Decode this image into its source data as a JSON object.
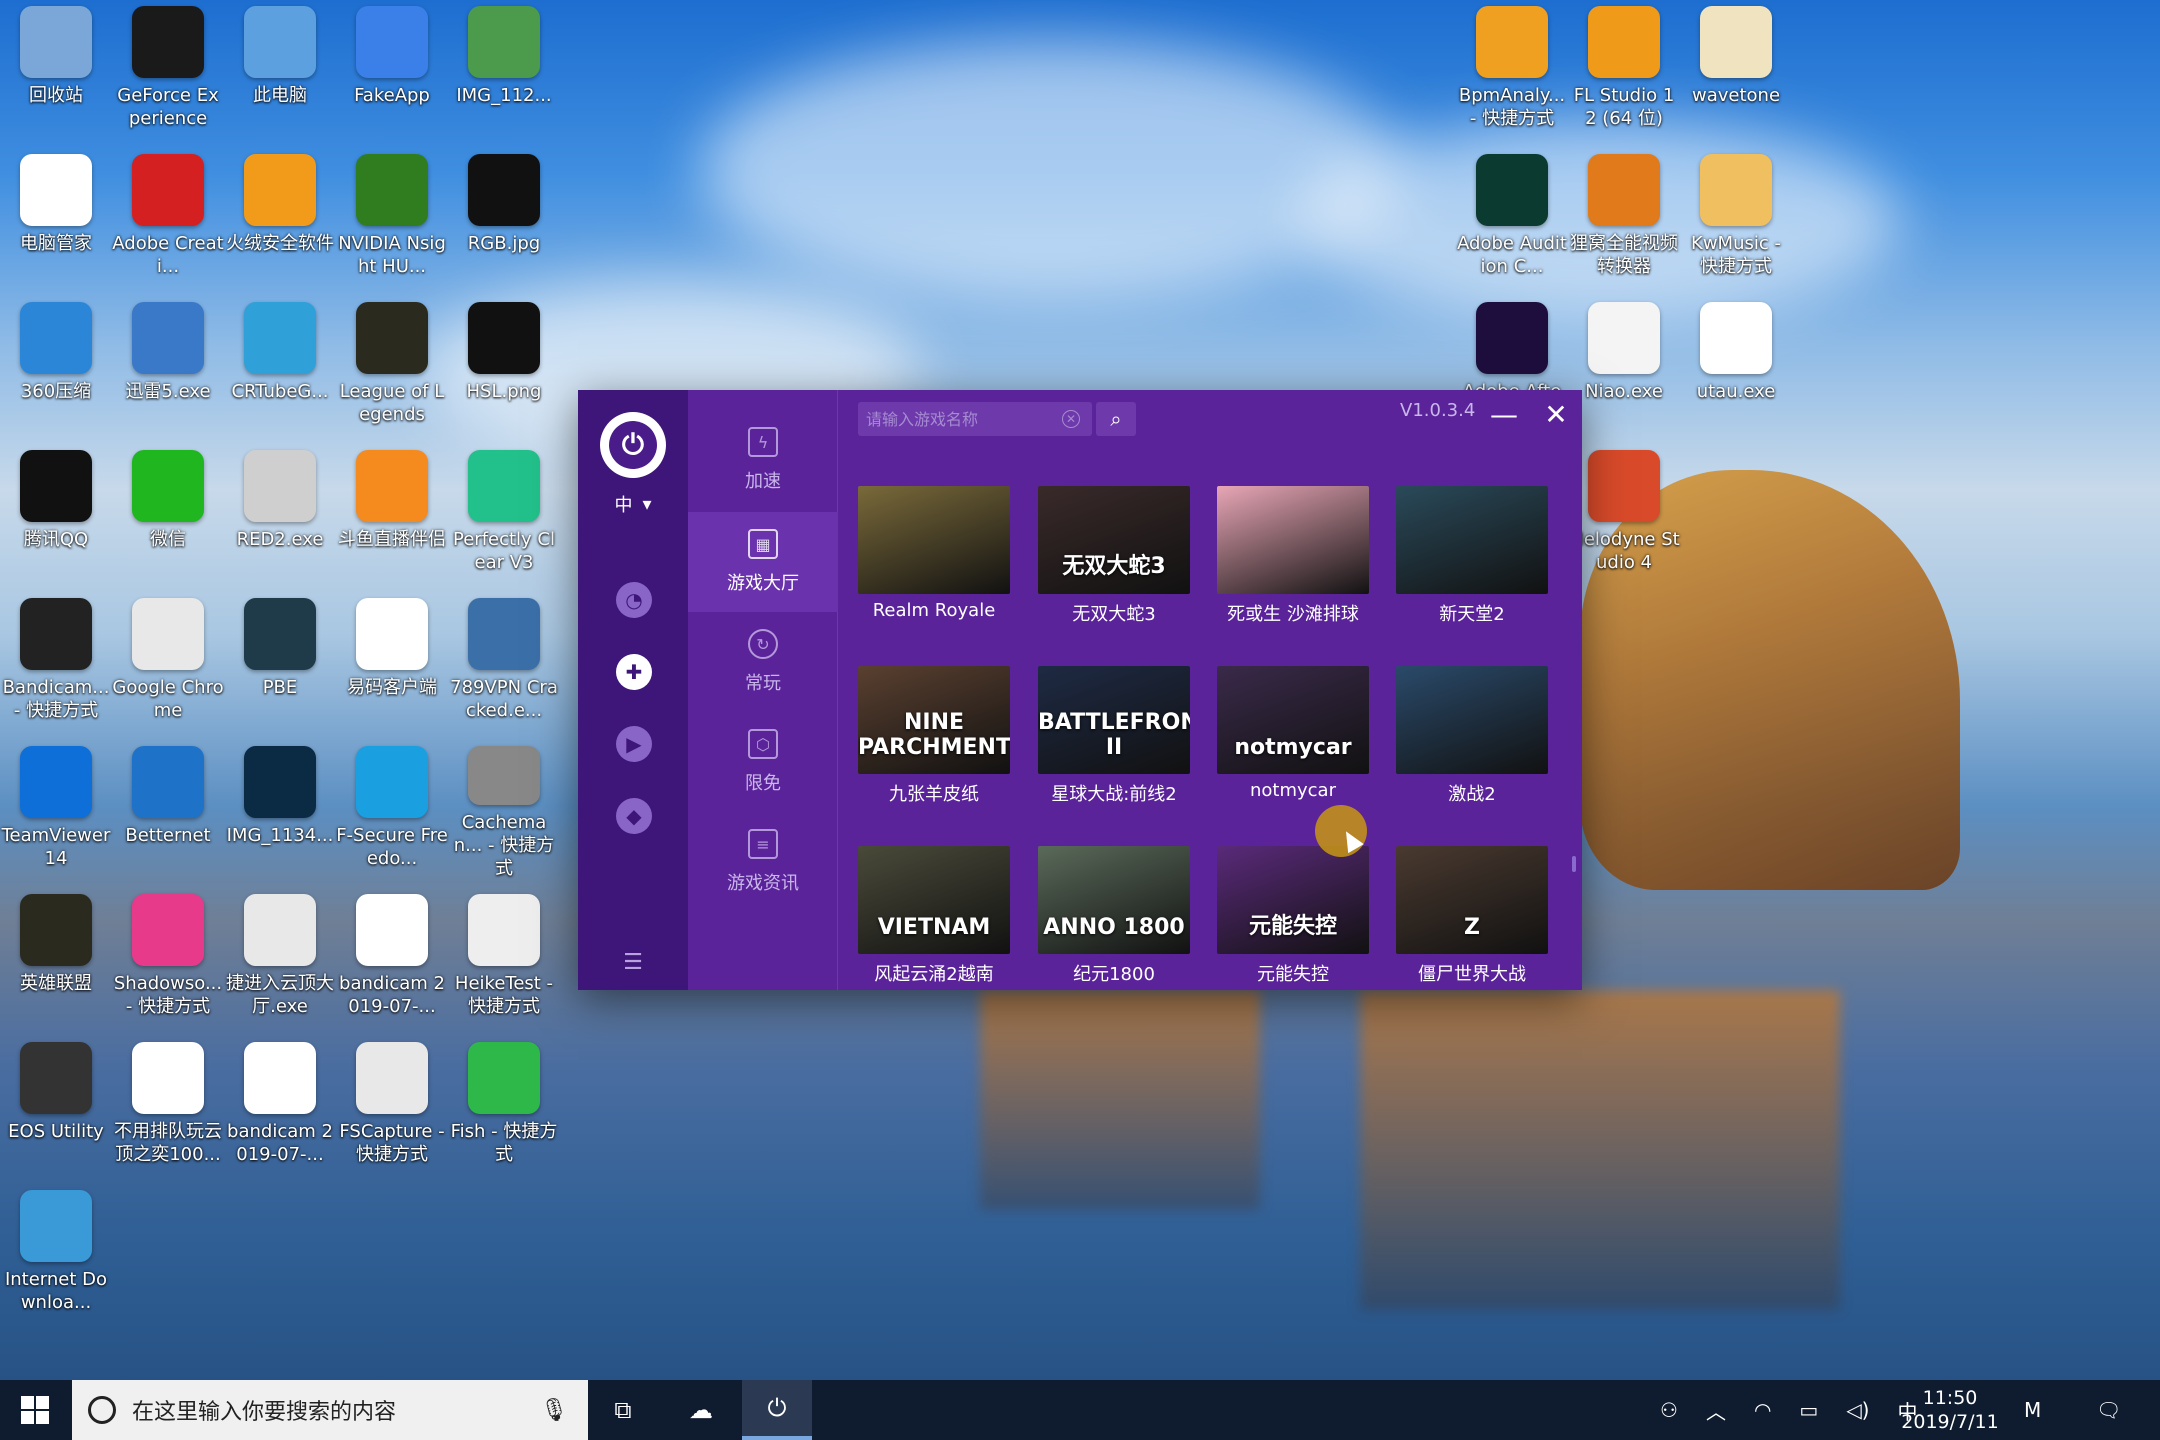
{
  "desktop_icons": [
    {
      "label": "回收站",
      "icon": "recycle-bin-icon",
      "color": "#7aa7d8"
    },
    {
      "label": "GeForce Experience",
      "icon": "nvidia-icon",
      "color": "#1a1a1a"
    },
    {
      "label": "此电脑",
      "icon": "computer-icon",
      "color": "#5da0e0"
    },
    {
      "label": "FakeApp",
      "icon": "fakeapp-icon",
      "color": "#3b7fe8"
    },
    {
      "label": "IMG_112...",
      "icon": "image-icon",
      "color": "#4c9a4c"
    },
    {
      "label": "电脑管家",
      "icon": "pc-manager-icon",
      "color": "#ffffff"
    },
    {
      "label": "Adobe Creati...",
      "icon": "adobe-cc-icon",
      "color": "#d42020"
    },
    {
      "label": "火绒安全软件",
      "icon": "huorong-icon",
      "color": "#f29a1a"
    },
    {
      "label": "NVIDIA Nsight HU...",
      "icon": "nsight-icon",
      "color": "#2f7d1e"
    },
    {
      "label": "RGB.jpg",
      "icon": "image-icon",
      "color": "#111111"
    },
    {
      "label": "360压缩",
      "icon": "archive-icon",
      "color": "#2b86d8"
    },
    {
      "label": "迅雷5.exe",
      "icon": "thunder-icon",
      "color": "#3a78c8"
    },
    {
      "label": "CRTubeG...",
      "icon": "crtube-icon",
      "color": "#2fa0d8"
    },
    {
      "label": "League of Legends",
      "icon": "lol-icon",
      "color": "#2b2a1e"
    },
    {
      "label": "HSL.png",
      "icon": "image-icon",
      "color": "#111111"
    },
    {
      "label": "腾讯QQ",
      "icon": "qq-icon",
      "color": "#111111"
    },
    {
      "label": "微信",
      "icon": "wechat-icon",
      "color": "#1fb61f"
    },
    {
      "label": "RED2.exe",
      "icon": "red2-icon",
      "color": "#cfcfcf"
    },
    {
      "label": "斗鱼直播伴侣",
      "icon": "douyu-icon",
      "color": "#f58a1e"
    },
    {
      "label": "Perfectly Clear V3",
      "icon": "perfectly-clear-icon",
      "color": "#22c08a"
    },
    {
      "label": "Bandicam... - 快捷方式",
      "icon": "bandicam-icon",
      "color": "#222222"
    },
    {
      "label": "Google Chrome",
      "icon": "chrome-icon",
      "color": "#e8e8e8"
    },
    {
      "label": "PBE",
      "icon": "lol-icon",
      "color": "#1f3a48"
    },
    {
      "label": "易码客户端",
      "icon": "yima-icon",
      "color": "#ffffff"
    },
    {
      "label": "789VPN Cracked.e...",
      "icon": "vpn-icon",
      "color": "#3b6fa8"
    },
    {
      "label": "TeamViewer 14",
      "icon": "teamviewer-icon",
      "color": "#0e6fd8"
    },
    {
      "label": "Betternet",
      "icon": "betternet-icon",
      "color": "#1e72c8"
    },
    {
      "label": "IMG_1134...",
      "icon": "photoshop-icon",
      "color": "#0b2a44"
    },
    {
      "label": "F-Secure Freedo...",
      "icon": "fsecure-icon",
      "color": "#1aa0e0"
    },
    {
      "label": "Cacheman... - 快捷方式",
      "icon": "cacheman-icon",
      "color": "#888888"
    },
    {
      "label": "英雄联盟",
      "icon": "lol-icon",
      "color": "#2b2a1e"
    },
    {
      "label": "Shadowso... - 快捷方式",
      "icon": "shadowsocks-icon",
      "color": "#e83a8a"
    },
    {
      "label": "捷进入云顶大厅.exe",
      "icon": "exe-icon",
      "color": "#e8e8e8"
    },
    {
      "label": "bandicam 2019-07-...",
      "icon": "video-file-icon",
      "color": "#ffffff"
    },
    {
      "label": "HeikeTest - 快捷方式",
      "icon": "heiketest-icon",
      "color": "#eeeeee"
    },
    {
      "label": "EOS Utility",
      "icon": "camera-icon",
      "color": "#333333"
    },
    {
      "label": "不用排队玩云顶之奕100...",
      "icon": "video-file-icon",
      "color": "#ffffff"
    },
    {
      "label": "bandicam 2019-07-...",
      "icon": "video-file-icon",
      "color": "#ffffff"
    },
    {
      "label": "FSCapture - 快捷方式",
      "icon": "fscapture-icon",
      "color": "#e8e8e8"
    },
    {
      "label": "Fish - 快捷方式",
      "icon": "fish-icon",
      "color": "#2fb84a"
    },
    {
      "label": "Internet Downloa...",
      "icon": "idm-icon",
      "color": "#3a9ad8"
    },
    {
      "label": "BpmAnaly... - 快捷方式",
      "icon": "bpm-icon",
      "color": "#f0a020"
    },
    {
      "label": "FL Studio 12 (64 位)",
      "icon": "flstudio-icon",
      "color": "#f09a1a"
    },
    {
      "label": "wavetone",
      "icon": "wavetone-icon",
      "color": "#f0e4c0"
    },
    {
      "label": "Adobe Audition C...",
      "icon": "audition-icon",
      "color": "#0a3a30"
    },
    {
      "label": "狸窝全能视频转换器",
      "icon": "converter-icon",
      "color": "#e07a1a"
    },
    {
      "label": "KwMusic - 快捷方式",
      "icon": "kwmusic-icon",
      "color": "#f0c060"
    },
    {
      "label": "Adobe After...",
      "icon": "aftereffects-icon",
      "color": "#1e0e3e"
    },
    {
      "label": "Niao.exe",
      "icon": "blank-file-icon",
      "color": "#f4f4f4"
    },
    {
      "label": "utau.exe",
      "icon": "utau-icon",
      "color": "#ffffff"
    },
    {
      "label": "Melodyne Studio 4",
      "icon": "melodyne-icon",
      "color": "#d84a2a"
    }
  ],
  "app": {
    "language": "中",
    "nav": [
      {
        "label": "加速",
        "icon": "lightning-icon"
      },
      {
        "label": "游戏大厅",
        "icon": "grid-icon"
      },
      {
        "label": "常玩",
        "icon": "refresh-icon"
      },
      {
        "label": "限免",
        "icon": "box-icon"
      },
      {
        "label": "游戏资讯",
        "icon": "news-icon"
      }
    ],
    "search_placeholder": "请输入游戏名称",
    "version": "V1.0.3.4",
    "minimize": "—",
    "close": "✕",
    "games": [
      {
        "name": "Realm Royale",
        "color": "#7a6a3a",
        "art": ""
      },
      {
        "name": "无双大蛇3",
        "color": "#3a2a2a",
        "art": "无双大蛇3"
      },
      {
        "name": "死或生 沙滩排球",
        "color": "#e8a6b6",
        "art": ""
      },
      {
        "name": "新天堂2",
        "color": "#2a4a5a",
        "art": ""
      },
      {
        "name": "九张羊皮纸",
        "color": "#5a4030",
        "art": "NINE PARCHMENTS"
      },
      {
        "name": "星球大战:前线2",
        "color": "#1e2a44",
        "art": "BATTLEFRONT II"
      },
      {
        "name": "notmycar",
        "color": "#3a2a4a",
        "art": "notmycar"
      },
      {
        "name": "激战2",
        "color": "#2a4a6a",
        "art": ""
      },
      {
        "name": "风起云涌2越南",
        "color": "#4a4a3a",
        "art": "VIETNAM"
      },
      {
        "name": "纪元1800",
        "color": "#5a6a5a",
        "art": "ANNO 1800"
      },
      {
        "name": "元能失控",
        "color": "#5a2a7a",
        "art": "元能失控"
      },
      {
        "name": "僵尸世界大战",
        "color": "#4a3a30",
        "art": "Z"
      }
    ]
  },
  "taskbar": {
    "search_placeholder": "在这里输入你要搜索的内容",
    "ime": "中",
    "time": "11:50",
    "date": "2019/7/11"
  }
}
